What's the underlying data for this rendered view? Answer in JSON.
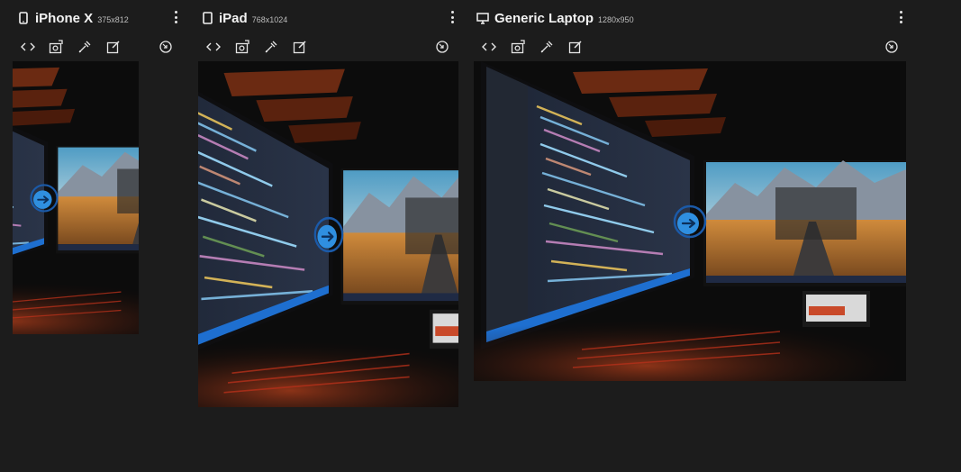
{
  "devices": [
    {
      "id": "iphone-x",
      "icon": "phone-icon",
      "name": "iPhone X",
      "dimensions": "375x812",
      "tools": [
        "code-icon",
        "screenshot-icon",
        "eyedropper-icon",
        "edit-icon",
        "rotate-icon"
      ]
    },
    {
      "id": "ipad",
      "icon": "tablet-icon",
      "name": "iPad",
      "dimensions": "768x1024",
      "tools": [
        "code-icon",
        "screenshot-icon",
        "eyedropper-icon",
        "edit-icon",
        "rotate-icon"
      ]
    },
    {
      "id": "generic-laptop",
      "icon": "monitor-icon",
      "name": "Generic Laptop",
      "dimensions": "1280x950",
      "tools": [
        "code-icon",
        "screenshot-icon",
        "eyedropper-icon",
        "edit-icon",
        "rotate-icon"
      ]
    }
  ],
  "preview_image": "dark desk setup with code editor monitor and mountain road wallpaper",
  "colors": {
    "background": "#1c1c1c",
    "text": "#f2f2f2",
    "subtext": "#bdbdbd",
    "cursor_blue": "#2f8fe0"
  }
}
